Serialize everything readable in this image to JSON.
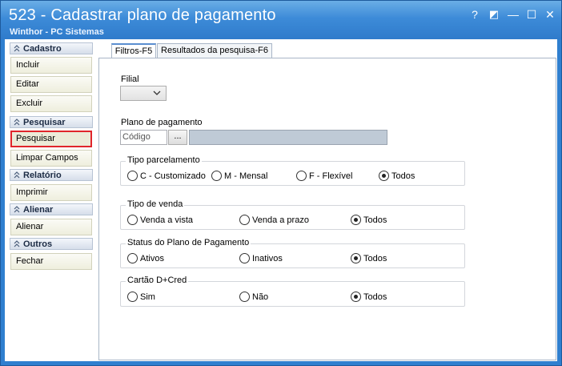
{
  "window": {
    "title": "523 - Cadastrar plano de pagamento",
    "subtitle": "Winthor - PC Sistemas",
    "help_label": "?",
    "restore_label": "◩",
    "minimize_label": "—",
    "maximize_label": "☐",
    "close_label": "✕"
  },
  "sidebar": {
    "sections": [
      {
        "title": "Cadastro",
        "items": [
          "Incluir",
          "Editar",
          "Excluir"
        ]
      },
      {
        "title": "Pesquisar",
        "items": [
          "Pesquisar",
          "Limpar Campos"
        ]
      },
      {
        "title": "Relatório",
        "items": [
          "Imprimir"
        ]
      },
      {
        "title": "Alienar",
        "items": [
          "Alienar"
        ]
      },
      {
        "title": "Outros",
        "items": [
          "Fechar"
        ]
      }
    ],
    "active_item": "Pesquisar"
  },
  "tabs": [
    {
      "label": "Filtros-F5",
      "selected": true
    },
    {
      "label": "Resultados da pesquisa-F6",
      "selected": false
    }
  ],
  "filters": {
    "filial": {
      "label": "Filial",
      "value": ""
    },
    "plano": {
      "label": "Plano de pagamento",
      "code_placeholder": "Código",
      "ellipsis": "...",
      "description": ""
    },
    "tipo_parcelamento": {
      "title": "Tipo parcelamento",
      "options": [
        "C - Customizado",
        "M - Mensal",
        "F - Flexível",
        "Todos"
      ],
      "selected": "Todos"
    },
    "tipo_venda": {
      "title": "Tipo de venda",
      "options": [
        "Venda a vista",
        "Venda a prazo",
        "Todos"
      ],
      "selected": "Todos"
    },
    "status": {
      "title": "Status do Plano de Pagamento",
      "options": [
        "Ativos",
        "Inativos",
        "Todos"
      ],
      "selected": "Todos"
    },
    "cartao": {
      "title": "Cartão D+Cred",
      "options": [
        "Sim",
        "Não",
        "Todos"
      ],
      "selected": "Todos"
    }
  },
  "colors": {
    "accent": "#2f7fcf",
    "active_border": "#e0252b",
    "section_header": "#d6deea"
  }
}
